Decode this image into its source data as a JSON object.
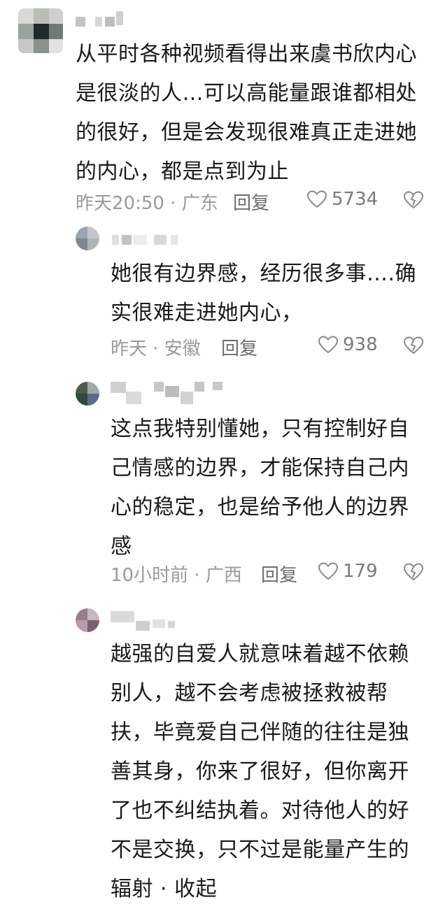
{
  "comments": [
    {
      "text_lines": [
        "从平时各种视频看得出来虞书欣内心",
        "是很淡的人…可以高能量跟谁都相处",
        "的很好，但是会发现很难真正走进她",
        "的内心，都是点到为止"
      ],
      "time_location": "昨天20:50 · 广东",
      "reply_label": "回复",
      "like_count": "5734"
    },
    {
      "text_lines": [
        "她很有边界感，经历很多事….确",
        "实很难走进她内心，"
      ],
      "time_location": "昨天 · 安徽",
      "reply_label": "回复",
      "like_count": "938"
    },
    {
      "text_lines": [
        "这点我特别懂她，只有控制好自",
        "己情感的边界，才能保持自己内",
        "心的稳定，也是给予他人的边界",
        "感"
      ],
      "time_location": "10小时前 · 广西",
      "reply_label": "回复",
      "like_count": "179"
    },
    {
      "text_lines": [
        "越强的自爱人就意味着越不依赖",
        "别人，越不会考虑被拯救被帮",
        "扶，毕竟爱自己伴随的往往是独",
        "善其身，你来了很好，但你离开",
        "了也不纠结执着。对待他人的好",
        "不是交换，只不过是能量产生的",
        "辐射 · 收起"
      ]
    }
  ],
  "icons": {
    "like": "heart-outline-icon",
    "dislike": "broken-heart-icon"
  },
  "colors": {
    "text": "#1a1a1a",
    "meta": "#9a9a9a",
    "reply": "#6d6d6d"
  }
}
